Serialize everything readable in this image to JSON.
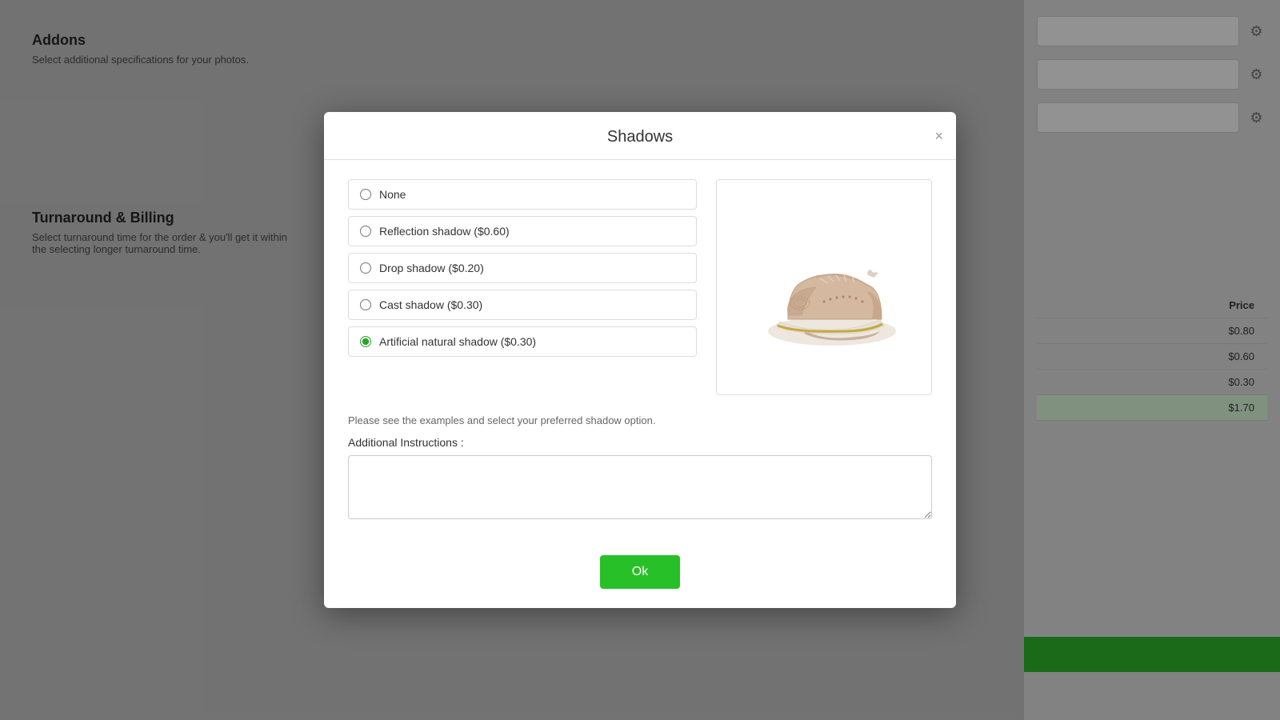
{
  "background": {
    "addons_title": "Addons",
    "addons_desc": "Select additional specifications for your photos.",
    "billing_title": "Turnaround & Billing",
    "billing_desc": "Select turnaround time for the order & you'll get it within the selecting longer turnaround time.",
    "table": {
      "header": "Price",
      "rows": [
        {
          "price": "$0.80"
        },
        {
          "price": "$0.60"
        },
        {
          "price": "$0.30"
        },
        {
          "price": "$1.70",
          "highlighted": true
        }
      ]
    }
  },
  "modal": {
    "title": "Shadows",
    "close_label": "×",
    "options": [
      {
        "id": "none",
        "label": "None",
        "checked": false
      },
      {
        "id": "reflection",
        "label": "Reflection shadow ($0.60)",
        "checked": false
      },
      {
        "id": "drop",
        "label": "Drop shadow ($0.20)",
        "checked": false
      },
      {
        "id": "cast",
        "label": "Cast shadow ($0.30)",
        "checked": false
      },
      {
        "id": "artificial",
        "label": "Artificial natural shadow ($0.30)",
        "checked": true
      }
    ],
    "info_text": "Please see the examples and select your preferred shadow option.",
    "additional_instructions_label": "Additional Instructions :",
    "additional_instructions_placeholder": "",
    "ok_label": "Ok"
  }
}
